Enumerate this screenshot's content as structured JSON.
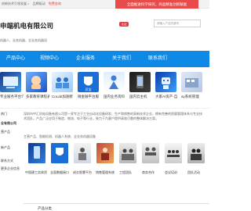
{
  "topbar": {
    "links": [
      "创新技术引领发展 >",
      "品牌驱动",
      "免费咨询"
    ],
    "notice": "全面推进科学研究，商品精准创新赋能"
  },
  "header": {
    "title": "申端机电有限公司",
    "badge": "认证",
    "search_placeholder": "请输入产品关键词",
    "subline": "机器人、业务机器、全业务机器设"
  },
  "nav": {
    "items": [
      "产品中心",
      "视频中心",
      "企业服务",
      "关于我们",
      "联系我们"
    ]
  },
  "banner": {
    "items": [
      {
        "caption": "专业服务平台介"
      },
      {
        "caption": "多家教育课程表"
      },
      {
        "caption": "CoLab加速孵"
      },
      {
        "caption": "微金融平台服"
      },
      {
        "caption": "国内业务资料"
      },
      {
        "caption": "国内云主机"
      },
      {
        "caption": "大家AI资产·自"
      },
      {
        "caption": "ay系统管理"
      }
    ]
  },
  "sidebar": {
    "items": [
      "热门",
      "业有限公司",
      "营产品",
      "新产品",
      "联系方式",
      "更多企业信息"
    ]
  },
  "main": {
    "paragraph": "深圳市中汇机电设备有限公司是一家专注于工业自动化设备研发、生产和销售的高新技术企业，拥有完善的质量管理体系与专业技术团队，产品广泛应用于制造、物流、电子等行业，致力于为客户提供高效可靠的整体解决方案。",
    "subhead": "主营产品、智能检测、机器人系统、全业务机器设备",
    "products": [
      {
        "caption": "中国建工实体资"
      },
      {
        "caption": "全面数据接口"
      },
      {
        "caption": "成交智慧平台"
      },
      {
        "caption": "销售管理系统"
      },
      {
        "caption": "工程团队"
      },
      {
        "caption": "商务合作"
      },
      {
        "caption": "会议培训"
      },
      {
        "caption": "团队活动"
      }
    ],
    "section_title": "产品分类"
  },
  "colors": {
    "nav_bg": "#0e89e6",
    "accent_red": "#e4393c",
    "notice_bg": "#e94a4a"
  }
}
